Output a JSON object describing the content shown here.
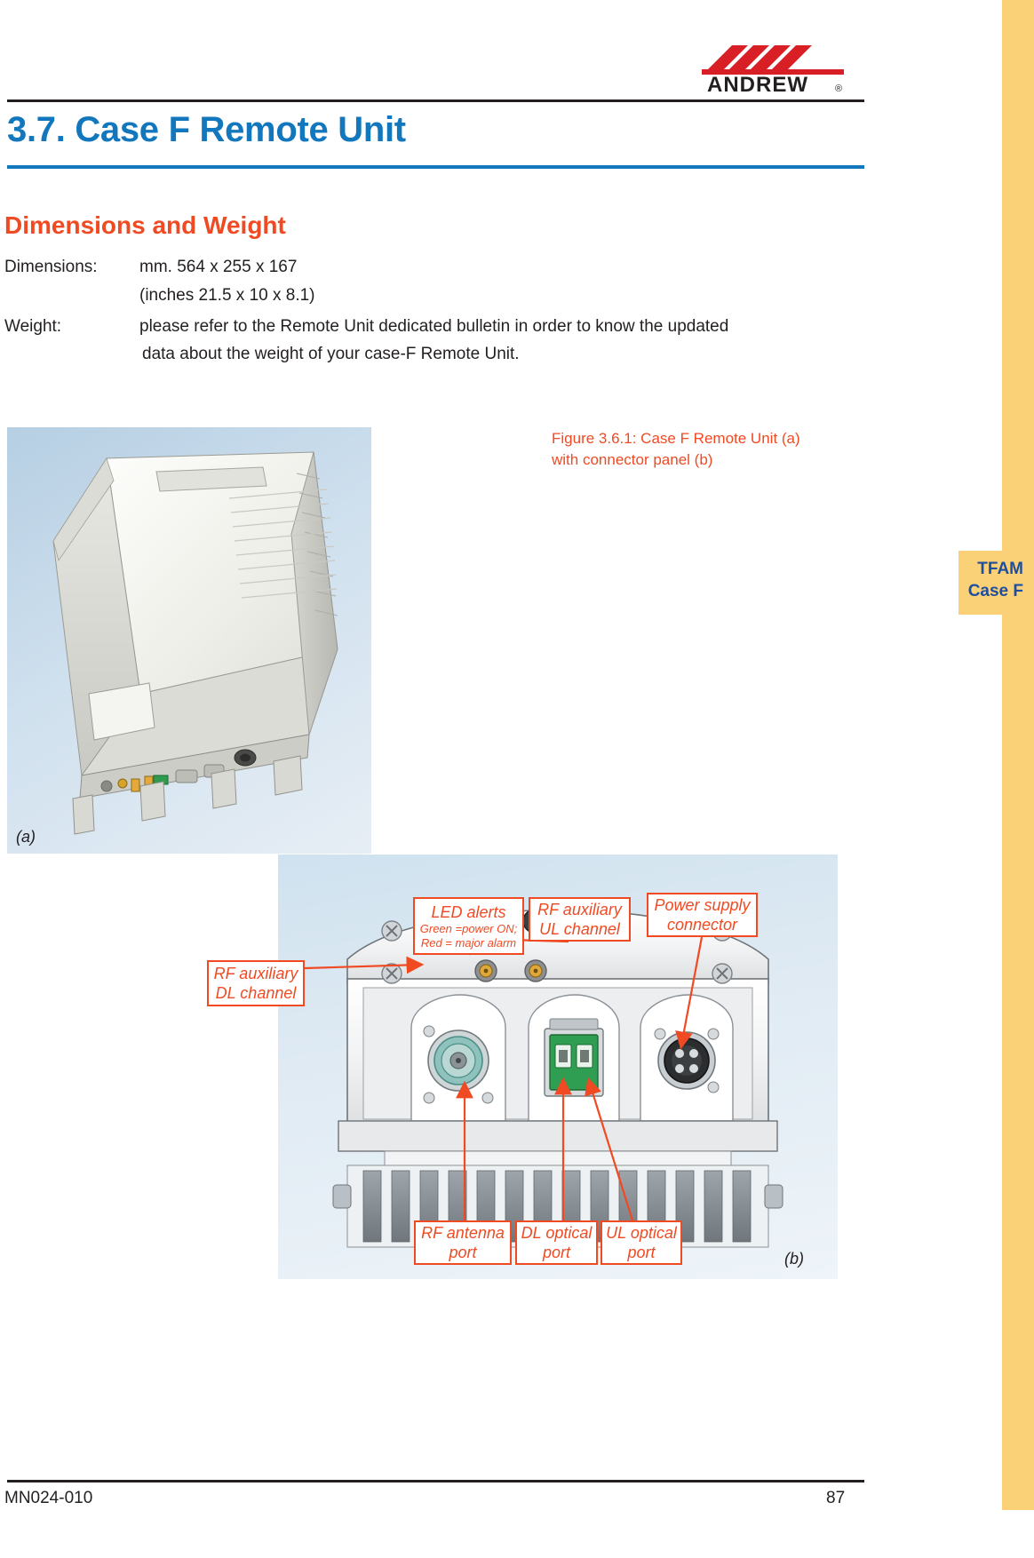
{
  "brand": {
    "logo_text": "ANDREW",
    "logo_mark": "chevrons-icon",
    "registered": "®"
  },
  "header": {
    "chapter_title": "3.7. Case F Remote Unit",
    "section_title": "Dimensions and Weight"
  },
  "specs": {
    "dimensions_label": "Dimensions:",
    "dimensions_mm": "mm. 564 x 255 x 167",
    "dimensions_in": "(inches 21.5 x 10 x 8.1)",
    "weight_label": "Weight:",
    "weight_line1": "please refer to the Remote Unit dedicated bulletin in order to know the updated",
    "weight_line2": "data about the weight  of your case-F Remote Unit."
  },
  "figure": {
    "caption_line1": "Figure 3.6.1: Case F Remote Unit (a)",
    "caption_line2": "with connector panel (b)",
    "photo_a_tag": "(a)",
    "photo_b_tag": "(b)"
  },
  "callouts": {
    "led_title": "LED alerts",
    "led_sub1": "Green =power ON;",
    "led_sub2": "Red = major alarm",
    "rf_aux_ul_1": "RF auxiliary",
    "rf_aux_ul_2": "UL channel",
    "power_1": "Power supply",
    "power_2": "connector",
    "rf_aux_dl_1": "RF auxiliary",
    "rf_aux_dl_2": "DL channel",
    "rf_antenna_1": "RF antenna",
    "rf_antenna_2": "port",
    "dl_optical_1": "DL optical",
    "dl_optical_2": "port",
    "ul_optical_1": "UL optical",
    "ul_optical_2": "port"
  },
  "side_tab": {
    "line1": "TFAM",
    "line2": "Case F"
  },
  "footer": {
    "doc_code": "MN024-010",
    "page_number": "87"
  },
  "colors": {
    "blue": "#1277bc",
    "orange": "#f04a23",
    "yellow_tab": "#fbd178",
    "tab_text_blue": "#1f4e9c",
    "black": "#231f20"
  }
}
